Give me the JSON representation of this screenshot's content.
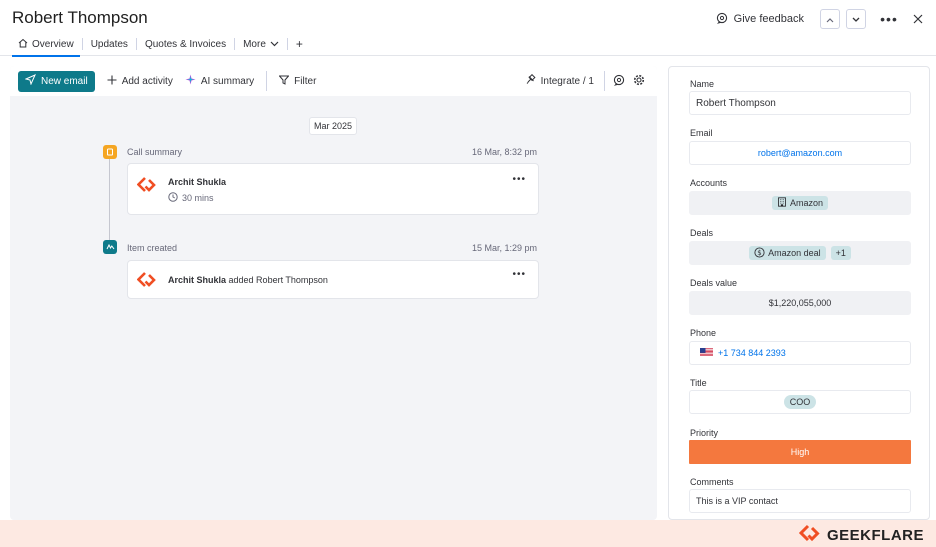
{
  "header": {
    "title": "Robert Thompson",
    "feedback_label": "Give feedback"
  },
  "tabs": [
    {
      "label": "Overview",
      "icon": "home-icon",
      "active": true
    },
    {
      "label": "Updates"
    },
    {
      "label": "Quotes & Invoices"
    },
    {
      "label": "More"
    }
  ],
  "toolbar": {
    "new_email": "New email",
    "add_activity": "Add activity",
    "ai_summary": "AI summary",
    "filter": "Filter",
    "integrate": "Integrate / 1"
  },
  "timeline": {
    "date_chip": "Mar 2025",
    "events": [
      {
        "label": "Call summary",
        "time": "16 Mar, 8:32 pm",
        "author": "Archit Shukla",
        "detail": "30 mins",
        "icon_color": "#f5a623"
      },
      {
        "label": "Item created",
        "time": "15 Mar, 1:29 pm",
        "author": "Archit Shukla",
        "detail": "added Robert Thompson",
        "icon_color": "#0e7a8a"
      }
    ]
  },
  "fields": {
    "name": {
      "label": "Name",
      "value": "Robert Thompson"
    },
    "email": {
      "label": "Email",
      "value": "robert@amazon.com"
    },
    "accounts": {
      "label": "Accounts",
      "value": "Amazon"
    },
    "deals": {
      "label": "Deals",
      "value": "Amazon deal",
      "extra": "+1"
    },
    "deals_value": {
      "label": "Deals value",
      "value": "$1,220,055,000"
    },
    "phone": {
      "label": "Phone",
      "value": "+1 734 844 2393"
    },
    "title": {
      "label": "Title",
      "value": "COO"
    },
    "priority": {
      "label": "Priority",
      "value": "High",
      "color": "#f4783e"
    },
    "comments": {
      "label": "Comments",
      "value": "This is a VIP contact"
    }
  },
  "watermark": {
    "text": "GEEKFLARE"
  },
  "colors": {
    "accent": "#0e7a8a",
    "link": "#0073ea",
    "brand_orange": "#f04e23"
  }
}
